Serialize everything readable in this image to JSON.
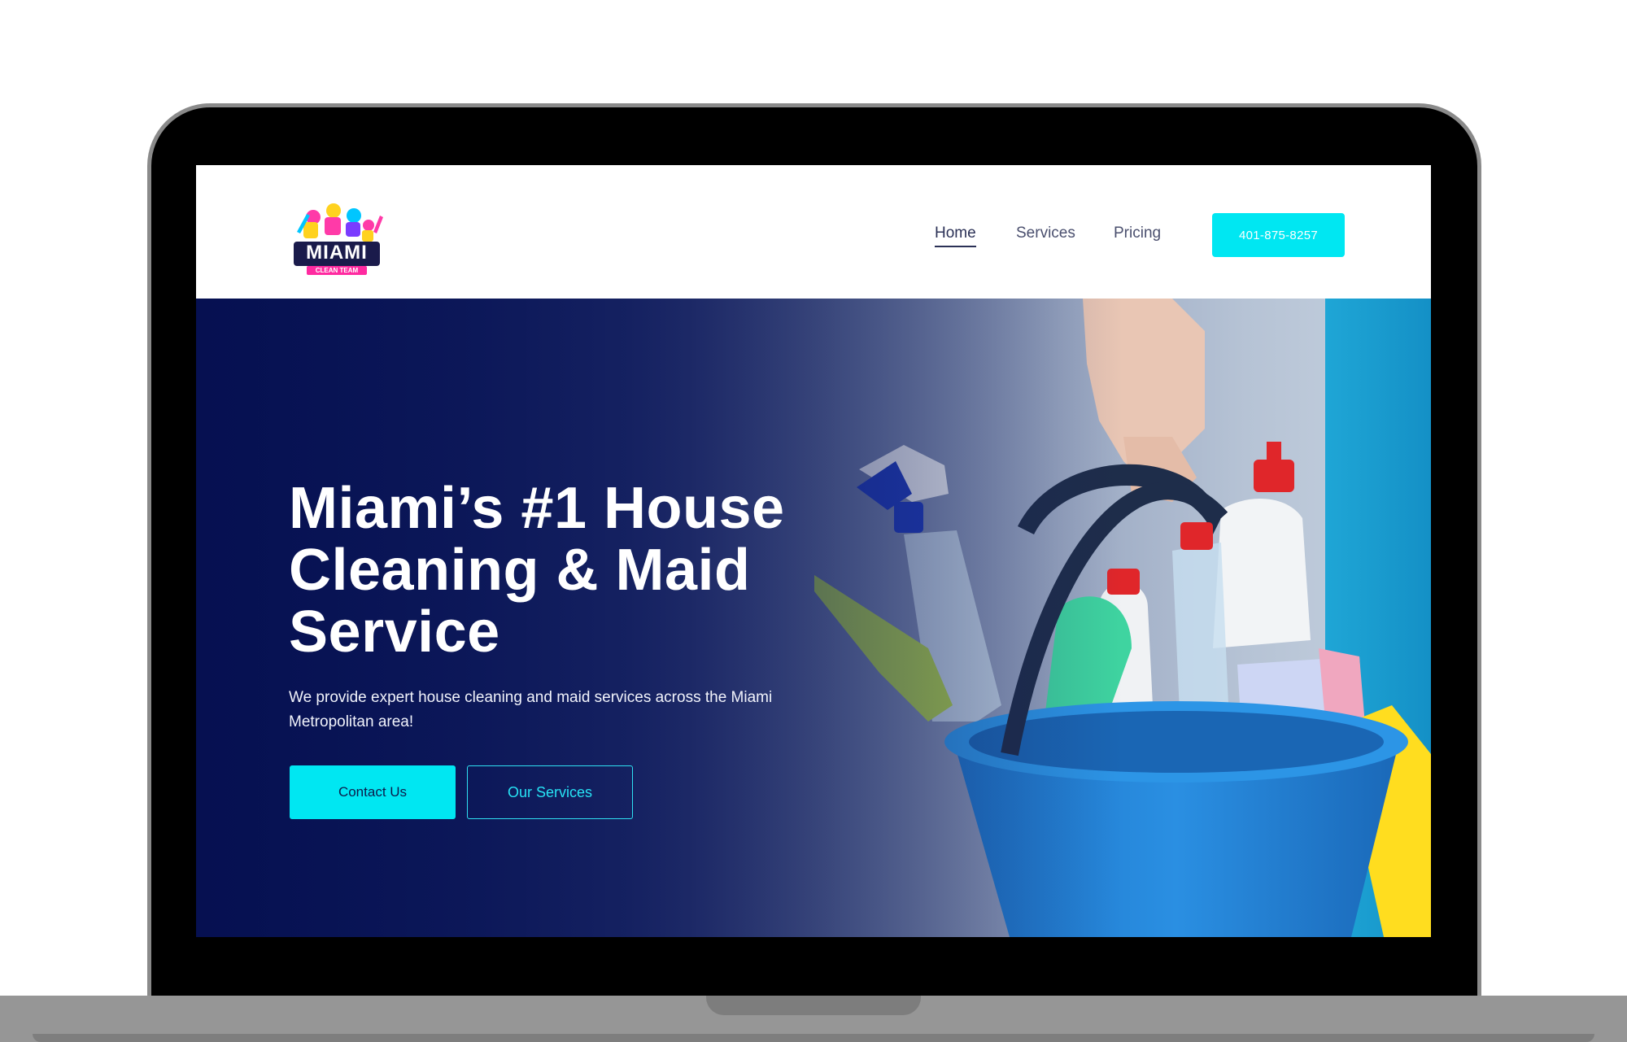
{
  "brand": {
    "logo_text": "MIAMI",
    "logo_tagline": "CLEAN TEAM"
  },
  "nav": {
    "items": [
      {
        "label": "Home",
        "active": true
      },
      {
        "label": "Services",
        "active": false
      },
      {
        "label": "Pricing",
        "active": false
      }
    ],
    "phone": "401-875-8257"
  },
  "hero": {
    "title": "Miami’s #1 House Cleaning & Maid Service",
    "subtitle": "We provide expert house cleaning and maid services across the Miami Metropolitan area!",
    "primary_button": "Contact Us",
    "secondary_button": "Our Services"
  },
  "colors": {
    "accent": "#00e7f2",
    "hero_overlay": "#0b1a5c",
    "nav_text": "#4a4f6e"
  }
}
